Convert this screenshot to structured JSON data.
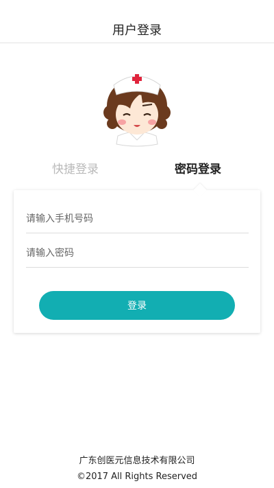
{
  "header": {
    "title": "用户登录"
  },
  "tabs": {
    "quick_login": "快捷登录",
    "password_login": "密码登录",
    "active": "password_login"
  },
  "form": {
    "phone_placeholder": "请输入手机号码",
    "password_placeholder": "请输入密码",
    "login_button": "登录"
  },
  "footer": {
    "company": "广东创医元信息技术有限公司",
    "copyright": "©2017 All Rights Reserved"
  },
  "colors": {
    "accent": "#12aeb2",
    "status_icon": "#8bd37a",
    "tab_inactive": "#b9b9b9",
    "nurse_cap_cross": "#e0243c"
  },
  "icons": {
    "status": "status-link-icon",
    "avatar": "nurse-avatar"
  }
}
